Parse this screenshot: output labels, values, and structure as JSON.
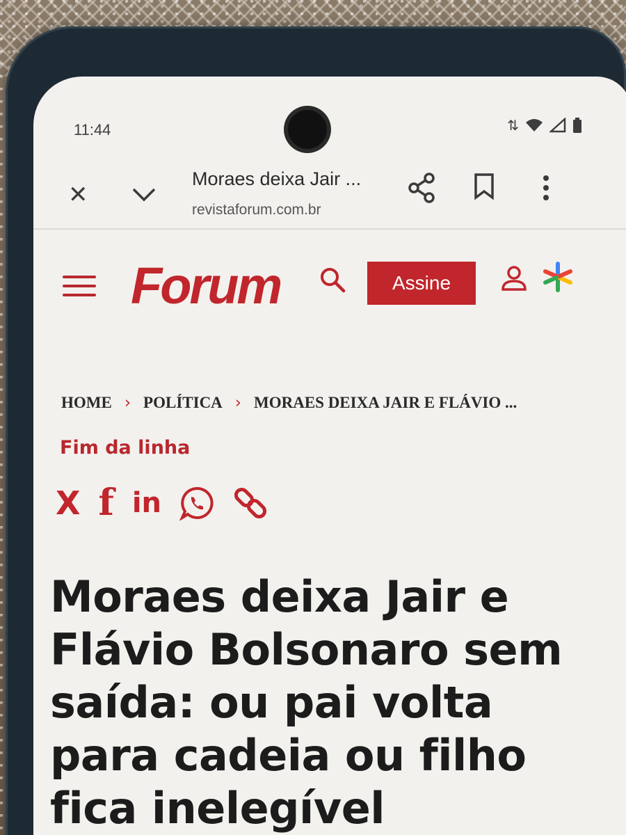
{
  "status_bar": {
    "time": "11:44"
  },
  "custom_tab": {
    "title": "Moraes deixa Jair ...",
    "url": "revistaforum.com.br",
    "icons": [
      "close-icon",
      "chevron-down-icon",
      "share-icon",
      "bookmark-icon",
      "more-vert-icon"
    ]
  },
  "site_header": {
    "logo": "Forum",
    "subscribe_label": "Assine",
    "icons": [
      "menu-icon",
      "search-icon",
      "user-icon",
      "asterisk-icon"
    ],
    "accent_color": "#c0262c"
  },
  "breadcrumb": {
    "items": [
      "HOME",
      "POLÍTICA",
      "MORAES DEIXA JAIR E FLÁVIO ..."
    ]
  },
  "article": {
    "kicker": "Fim da linha",
    "share_icons": [
      "x-icon",
      "facebook-icon",
      "linkedin-icon",
      "whatsapp-icon",
      "link-icon"
    ],
    "share_labels": {
      "x": "X",
      "facebook": "f",
      "linkedin": "in"
    },
    "headline": "Moraes deixa Jair e Flávio Bolsonaro sem saída: ou pai volta para cadeia ou filho fica inelegível"
  }
}
